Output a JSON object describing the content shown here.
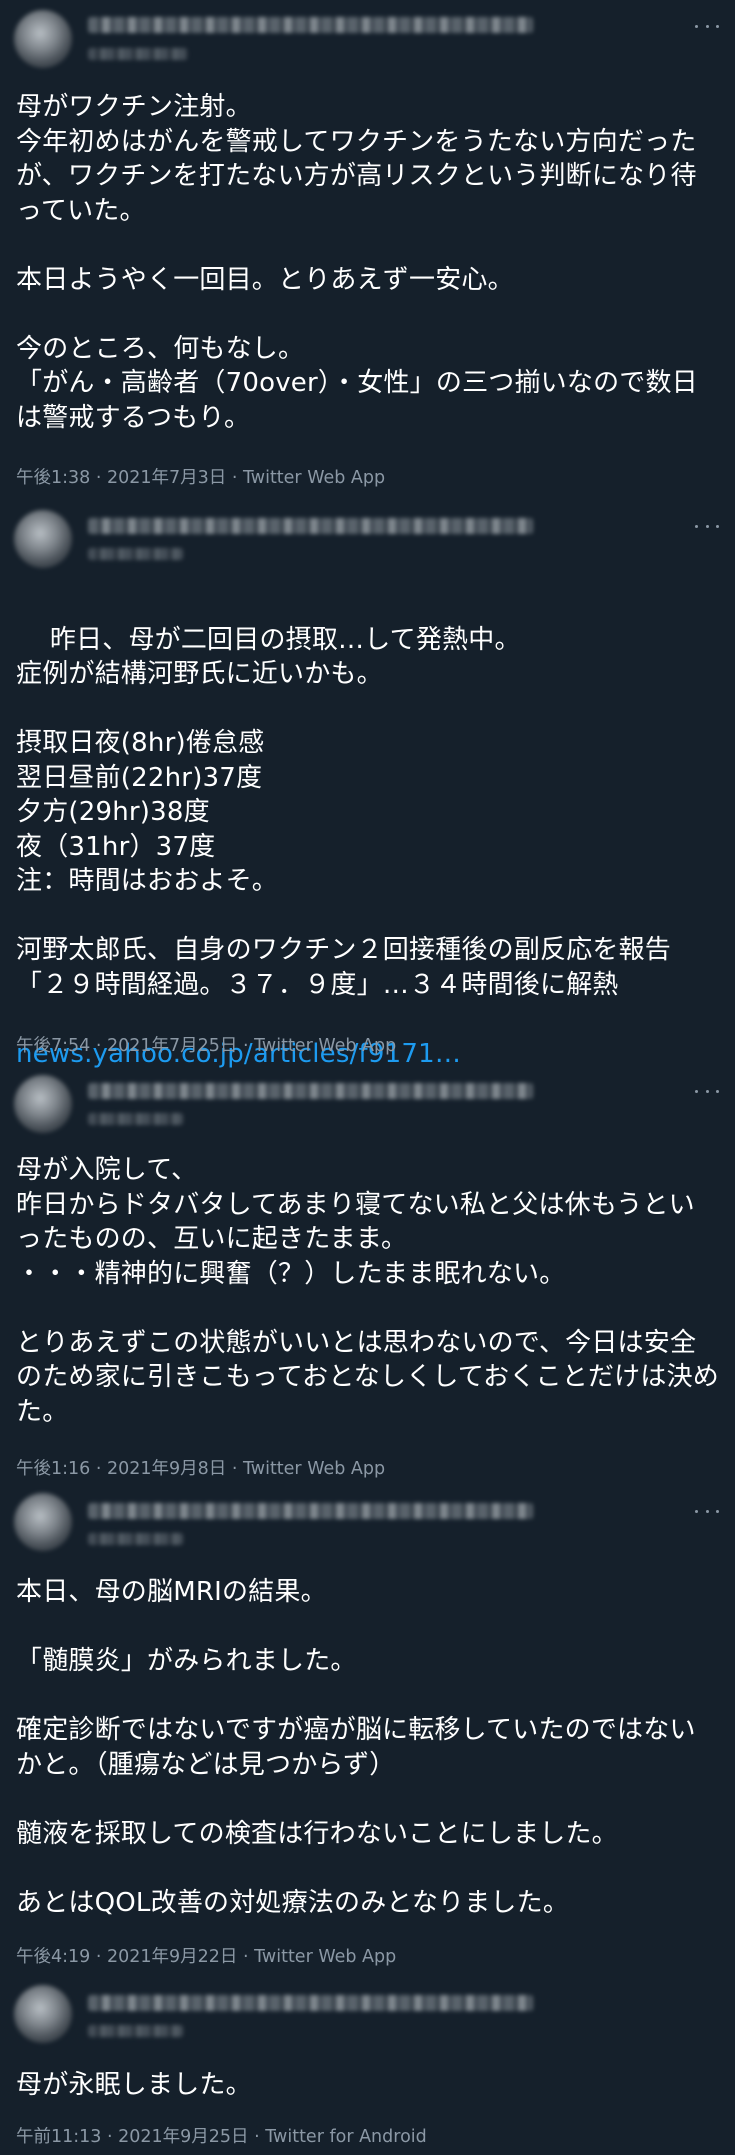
{
  "colors": {
    "background": "#15202b",
    "text": "#ffffff",
    "secondary_text": "#8b98a5",
    "link": "#1d9bf0"
  },
  "tweets": [
    {
      "text": "母がワクチン注射。\n今年初めはがんを警戒してワクチンをうたない方向だったが、ワクチンを打たない方が高リスクという判断になり待っていた。\n\n本日ようやく一回目。とりあえず一安心。\n\n今のところ、何もなし。\n「がん・高齢者（70over）・女性」の三つ揃いなので数日は警戒するつもり。",
      "link": "",
      "meta": "午後1:38 · 2021年7月3日 · Twitter Web App"
    },
    {
      "text": "昨日、母が二回目の摂取…して発熱中。\n症例が結構河野氏に近いかも。\n\n摂取日夜(8hr)倦怠感\n翌日昼前(22hr)37度\n夕方(29hr)38度\n夜（31hr）37度\n注：時間はおおよそ。\n\n河野太郎氏、自身のワクチン２回接種後の副反応を報告「２９時間経過。３７．９度」…３４時間後に解熱",
      "link": "news.yahoo.co.jp/articles/f9171…",
      "meta": "午後7:54 · 2021年7月25日 · Twitter Web App"
    },
    {
      "text": "母が入院して、\n昨日からドタバタしてあまり寝てない私と父は休もうといったものの、互いに起きたまま。\n・・・精神的に興奮（？）したまま眠れない。\n\nとりあえずこの状態がいいとは思わないので、今日は安全のため家に引きこもっておとなしくしておくことだけは決めた。",
      "link": "",
      "meta": "午後1:16 · 2021年9月8日 · Twitter Web App"
    },
    {
      "text": "本日、母の脳MRIの結果。\n\n「髄膜炎」がみられました。\n\n確定診断ではないですが癌が脳に転移していたのではないかと。（腫瘍などは見つからず）\n\n髄液を採取しての検査は行わないことにしました。\n\nあとはQOL改善の対処療法のみとなりました。",
      "link": "",
      "meta": "午後4:19 · 2021年9月22日 · Twitter Web App"
    },
    {
      "text": "母が永眠しました。",
      "link": "",
      "meta": "午前11:13 · 2021年9月25日 · Twitter for Android"
    }
  ]
}
